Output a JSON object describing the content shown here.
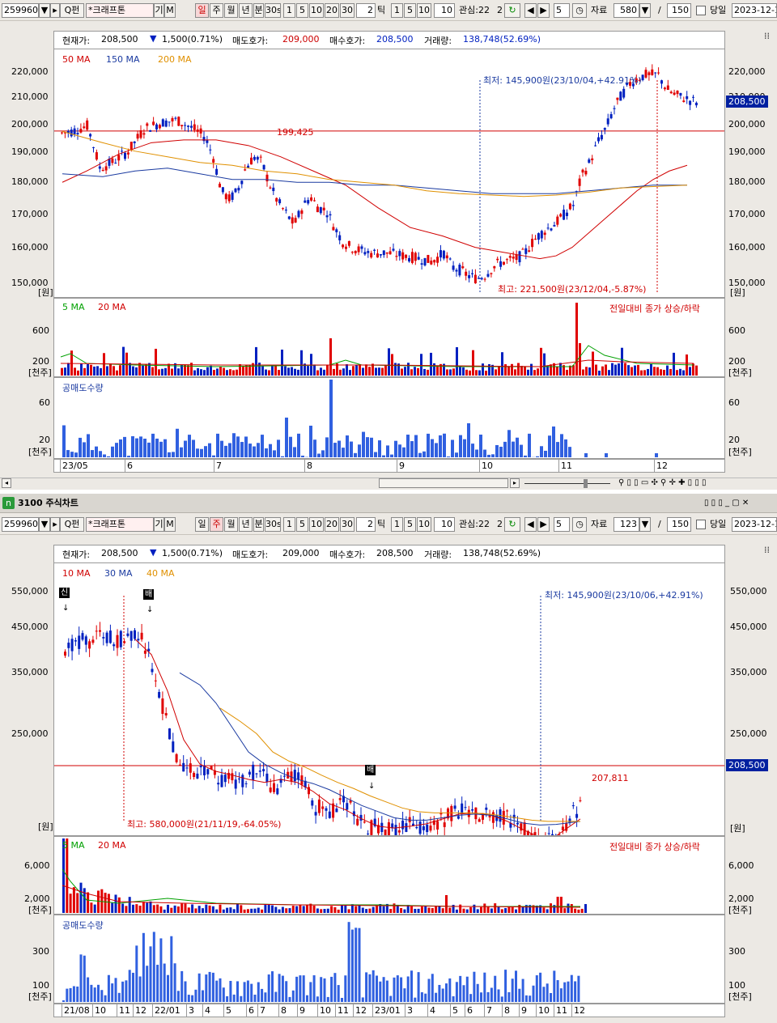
{
  "toolbar": {
    "code": "259960",
    "search_label": "Q펀",
    "name": "*크래프톤",
    "gi": "기",
    "m": "M",
    "periods": [
      "일",
      "주",
      "월",
      "년",
      "분",
      "30s"
    ],
    "ticks": [
      "1",
      "5",
      "10",
      "20",
      "30"
    ],
    "tick_input": "2",
    "tick_label": "틱",
    "ticks2": [
      "1",
      "5",
      "10"
    ],
    "input10": "10",
    "gwansim": "관심:22",
    "gw_tail": "2",
    "n5": "5",
    "jaryo": "자료",
    "jaryo_top": "580",
    "jaryo_bot": "123",
    "slash": "/",
    "total": "150",
    "dangil": "당일",
    "date": "2023-12-1"
  },
  "top": {
    "info": {
      "cur_label": "현재가:",
      "cur": "208,500",
      "change": "1,500(0.71%)",
      "ask_label": "매도호가:",
      "ask": "209,000",
      "bid_label": "매수호가:",
      "bid": "208,500",
      "vol_label": "거래량:",
      "vol": "138,748(52.69%)"
    },
    "legend": [
      {
        "name": "50 MA",
        "color": "#d00000"
      },
      {
        "name": "150 MA",
        "color": "#1a3aa0"
      },
      {
        "name": "200 MA",
        "color": "#f0a000"
      }
    ],
    "y_ticks": [
      "220,000",
      "210,000",
      "200,000",
      "190,000",
      "180,000",
      "170,000",
      "160,000",
      "150,000"
    ],
    "unit": "[원]",
    "price_box": "208,500",
    "hline_label": "199,425",
    "low_annotation": "최저: 145,900원(23/10/04,+42.91%)",
    "high_annotation": "최고: 221,500원(23/12/04,-5.87%)",
    "vol_legend": [
      {
        "name": "5 MA",
        "color": "#00a000"
      },
      {
        "name": "20 MA",
        "color": "#d00000"
      }
    ],
    "vol_note": "전일대비 종가 상승/하락",
    "vol_ticks": [
      "600",
      "200"
    ],
    "vol_unit": "[천주]",
    "short_legend": "공매도수량",
    "short_ticks": [
      "60",
      "20"
    ],
    "x_labels": [
      "23/05",
      "6",
      "7",
      "8",
      "9",
      "10",
      "11",
      "12"
    ]
  },
  "bottom": {
    "title": "3100 주식차트",
    "info": {
      "cur_label": "현재가:",
      "cur": "208,500",
      "change": "1,500(0.71%)",
      "ask_label": "매도호가:",
      "ask": "209,000",
      "bid_label": "매수호가:",
      "bid": "208,500",
      "vol_label": "거래량:",
      "vol": "138,748(52.69%)"
    },
    "legend": [
      {
        "name": "10 MA",
        "color": "#d00000"
      },
      {
        "name": "30 MA",
        "color": "#1a3aa0"
      },
      {
        "name": "40 MA",
        "color": "#f0a000"
      }
    ],
    "y_ticks": [
      "550,000",
      "450,000",
      "350,000",
      "250,000"
    ],
    "unit": "[원]",
    "price_box": "208,500",
    "hline_label": "207,811",
    "low_annotation": "최저: 145,900원(23/10/06,+42.91%)",
    "high_annotation": "최고: 580,000원(21/11/19,-64.05%)",
    "tag_new": "신",
    "tag_bae": "배",
    "vol_legend": [
      {
        "name": "5 MA",
        "color": "#00a000"
      },
      {
        "name": "20 MA",
        "color": "#d00000"
      }
    ],
    "vol_note": "전일대비 종가 상승/하락",
    "vol_ticks": [
      "6,000",
      "2,000"
    ],
    "vol_unit": "[천주]",
    "short_legend": "공매도수량",
    "short_ticks": [
      "300",
      "100"
    ],
    "x_labels": [
      "21/08",
      "10",
      "11",
      "12",
      "22/01",
      "3",
      "4",
      "5",
      "6",
      "7",
      "8",
      "9",
      "10",
      "11",
      "12",
      "23/01",
      "3",
      "4",
      "5",
      "6",
      "7",
      "8",
      "9",
      "10",
      "11",
      "12"
    ]
  },
  "colors": {
    "up": "#e00000",
    "down": "#0020c0",
    "short": "#3060e0"
  }
}
